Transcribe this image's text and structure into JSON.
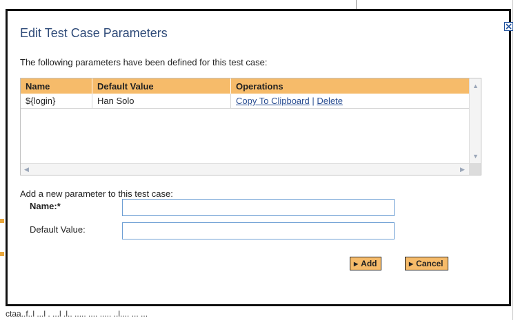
{
  "dialog": {
    "title": "Edit Test Case Parameters",
    "intro": "The following parameters have been defined for this test case:"
  },
  "table": {
    "headers": [
      "Name",
      "Default Value",
      "Operations"
    ],
    "rows": [
      {
        "name": "${login}",
        "default_value": "Han Solo",
        "copy_link": "Copy To Clipboard",
        "separator": "|",
        "delete_link": "Delete"
      }
    ]
  },
  "form": {
    "section_label": "Add a new parameter to this test case:",
    "name_label": "Name:*",
    "name_value": "",
    "default_label": "Default Value:",
    "default_value": "",
    "add_label": "Add",
    "cancel_label": "Cancel"
  },
  "background": {
    "bottom_text": "ctaa..f..l ...l . ...l .l.. ..... .... ..... ..l.... ... ..."
  },
  "colors": {
    "accent": "#f6bb6a",
    "title": "#2e4a78",
    "link": "#2b4f93",
    "field_border": "#6d9fd4"
  },
  "icons": {
    "close": "close-icon",
    "scroll_up": "chevron-up-icon",
    "scroll_down": "chevron-down-icon",
    "scroll_left": "chevron-left-icon",
    "scroll_right": "chevron-right-icon",
    "button_arrow": "triangle-right-icon"
  }
}
